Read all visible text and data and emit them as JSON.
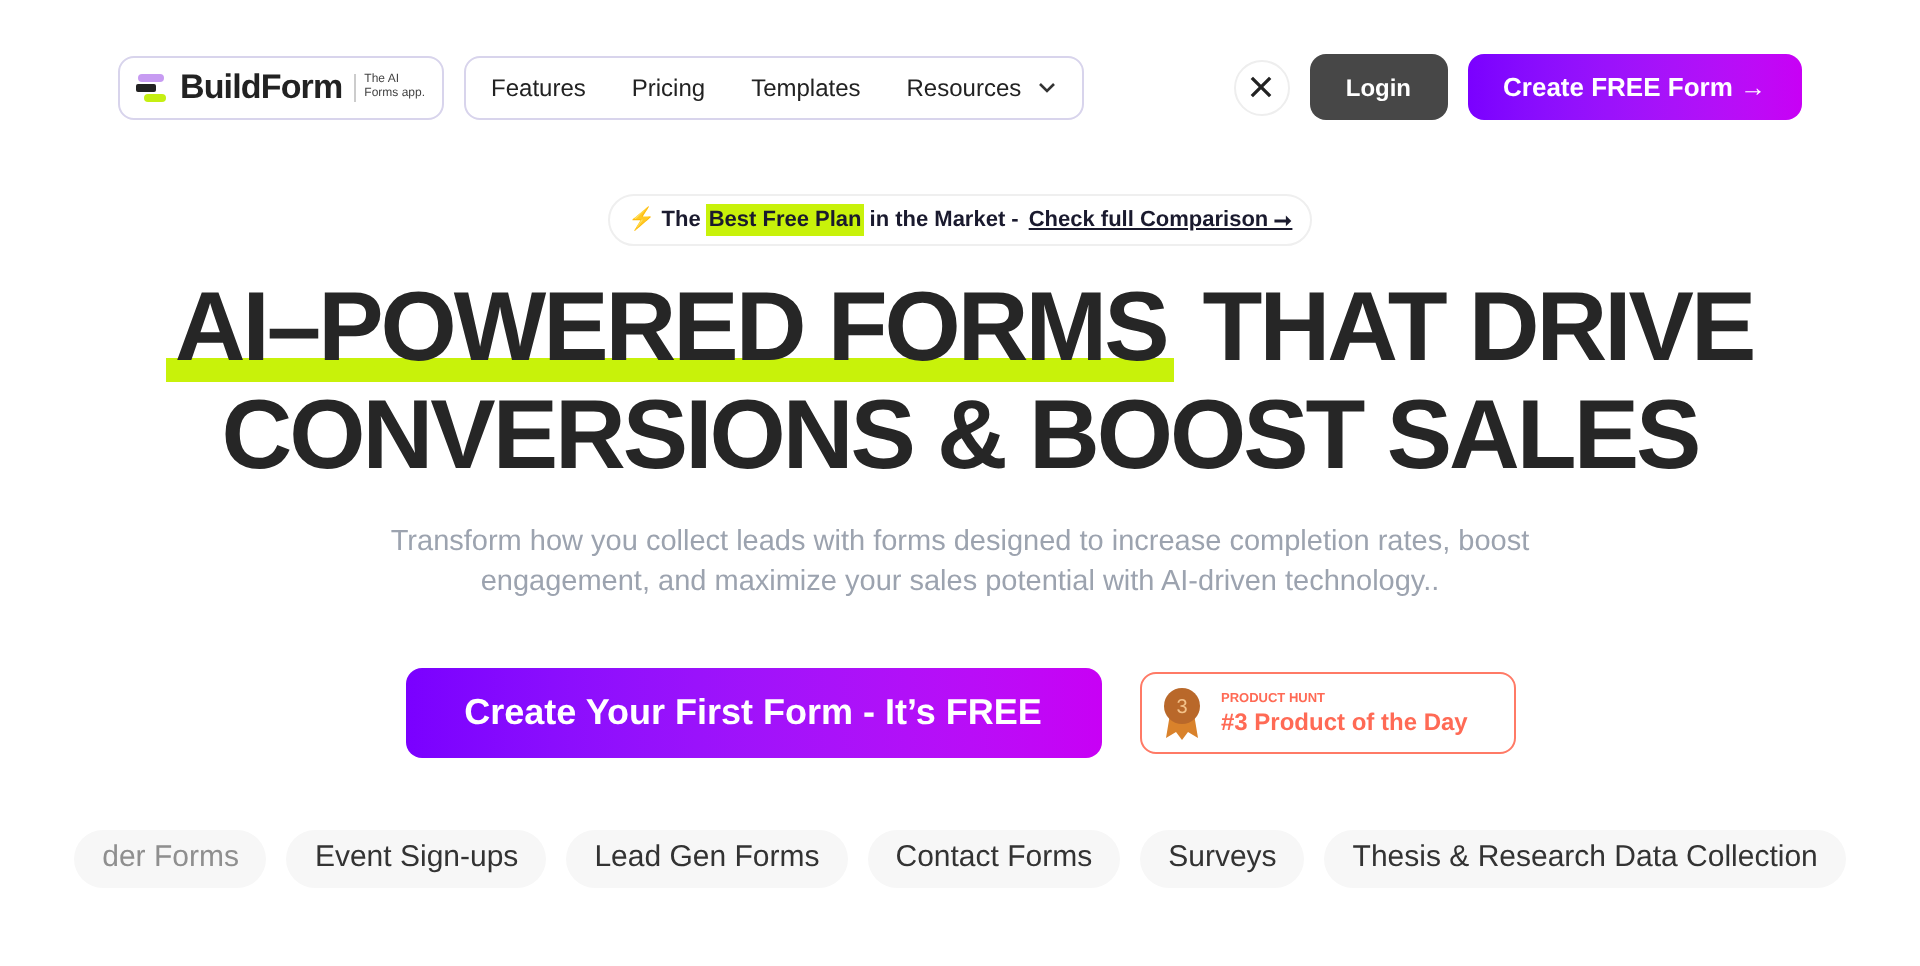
{
  "logo": {
    "name": "BuildForm",
    "tagline_1": "The AI",
    "tagline_2": "Forms app."
  },
  "nav": [
    {
      "label": "Features",
      "kind": "link"
    },
    {
      "label": "Pricing",
      "kind": "link"
    },
    {
      "label": "Templates",
      "kind": "link"
    },
    {
      "label": "Resources",
      "kind": "dropdown"
    }
  ],
  "actions": {
    "login": "Login",
    "cta": "Create FREE Form →"
  },
  "announcement": {
    "icon": "⚡",
    "before": "The",
    "highlight": "Best Free Plan",
    "after": "in the Market -",
    "link": "Check full Comparison ⭢"
  },
  "headline": {
    "highlight": "AI–POWERED FORMS",
    "line_1_rest": "THAT DRIVE",
    "line_2": "CONVERSIONS & BOOST SALES"
  },
  "subtitle": "Transform how you collect leads with forms designed to increase completion rates, boost engagement, and maximize your sales potential with AI-driven technology..",
  "primary_button": "Create Your First Form - It’s FREE",
  "badge": {
    "label": "PRODUCT HUNT",
    "rank": "3",
    "title": "#3 Product of the Day"
  },
  "chips": [
    "der Forms",
    "Event Sign-ups",
    "Lead Gen Forms",
    "Contact Forms",
    "Surveys",
    "Thesis & Research Data Collection"
  ]
}
